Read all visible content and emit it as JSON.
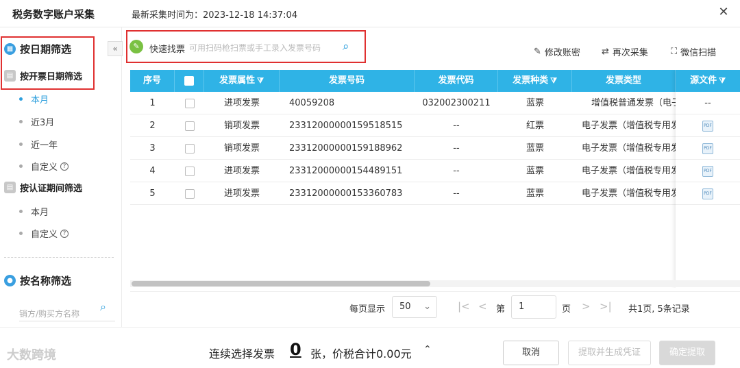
{
  "window": {
    "title": "税务数字账户采集",
    "last_collect_label": "最新采集时间为：",
    "last_collect_time": "2023-12-18 14:37:04",
    "close_glyph": "✕"
  },
  "sidebar": {
    "collapse_glyph": "«",
    "date_filter_title": "按日期筛选",
    "invoice_date_title": "按开票日期筛选",
    "invoice_date_options": [
      "本月",
      "近3月",
      "近一年",
      "自定义"
    ],
    "invoice_date_active_index": 0,
    "cert_period_title": "按认证期间筛选",
    "cert_period_options": [
      "本月",
      "自定义"
    ],
    "name_filter_title": "按名称筛选",
    "name_placeholder": "销方/购买方名称"
  },
  "toolbar": {
    "quick_find_label": "快速找票",
    "quick_find_placeholder": "可用扫码枪扫票或手工录入发票号码",
    "modify_account_label": "修改账密",
    "recollect_label": "再次采集",
    "wechat_scan_label": "微信扫描"
  },
  "table": {
    "columns": [
      "序号",
      "",
      "发票属性",
      "发票号码",
      "发票代码",
      "发票种类",
      "发票类型",
      "源文件"
    ],
    "rows": [
      {
        "no": "1",
        "attr": "进项发票",
        "number": "40059208",
        "code": "032002300211",
        "kind": "蓝票",
        "type": "增值税普通发票（电子",
        "file": "--"
      },
      {
        "no": "2",
        "attr": "销项发票",
        "number": "23312000000159518515",
        "code": "--",
        "kind": "红票",
        "type": "电子发票（增值税专用发",
        "file": "pdf-icon"
      },
      {
        "no": "3",
        "attr": "销项发票",
        "number": "23312000000159188962",
        "code": "--",
        "kind": "蓝票",
        "type": "电子发票（增值税专用发",
        "file": "pdf-icon"
      },
      {
        "no": "4",
        "attr": "进项发票",
        "number": "23312000000154489151",
        "code": "--",
        "kind": "蓝票",
        "type": "电子发票（增值税专用发",
        "file": "pdf-icon"
      },
      {
        "no": "5",
        "attr": "进项发票",
        "number": "23312000000153360783",
        "code": "--",
        "kind": "蓝票",
        "type": "电子发票（增值税专用发",
        "file": "pdf-icon"
      }
    ]
  },
  "pager": {
    "per_page_label": "每页显示",
    "per_page_value": "50",
    "page_prefix": "第",
    "page_value": "1",
    "page_suffix": "页",
    "summary": "共1页, 5条记录"
  },
  "footer": {
    "watermark": "大数跨境",
    "select_label": "连续选择发票",
    "selected_count": "0",
    "total_text": "张，价税合计0.00元",
    "cancel_label": "取消",
    "extract_gen_label": "提取并生成凭证",
    "confirm_label": "确定提取"
  }
}
